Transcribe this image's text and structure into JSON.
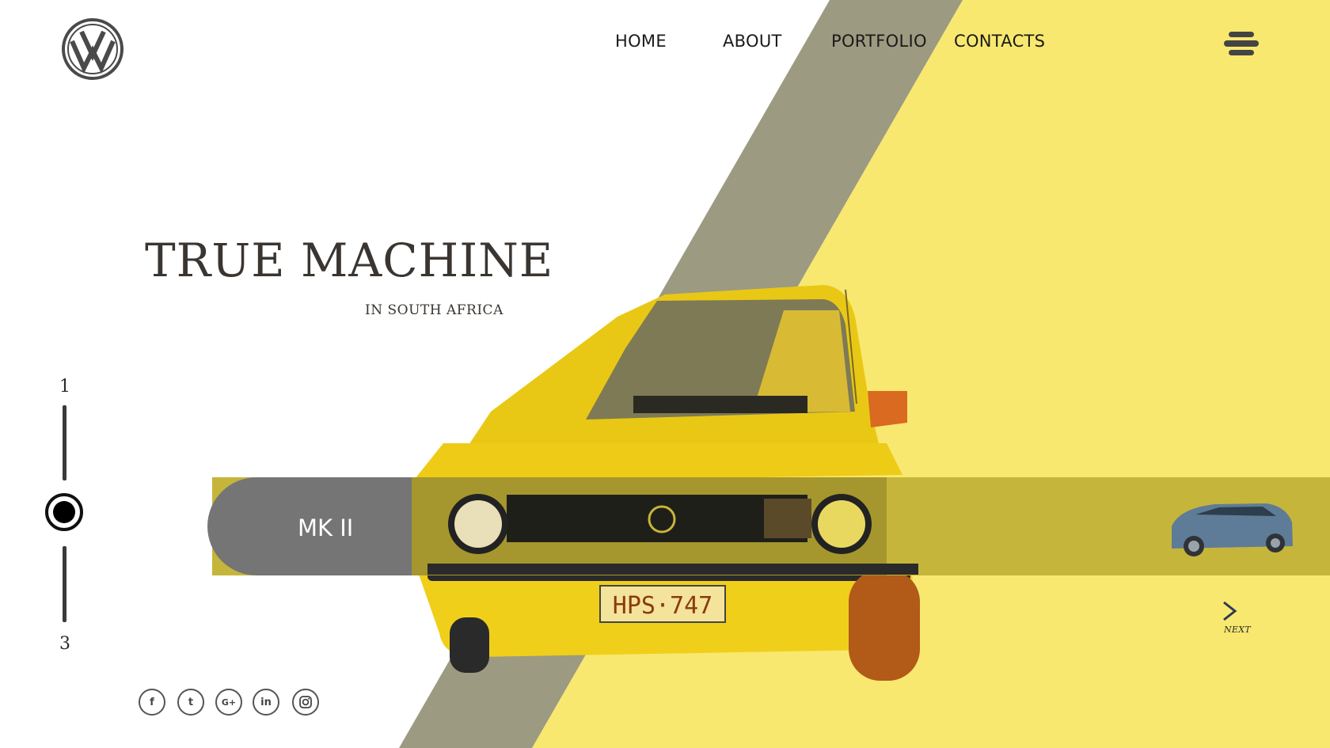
{
  "brand": {
    "logo": "vw-logo-icon"
  },
  "nav": {
    "items": [
      {
        "label": "HOME"
      },
      {
        "label": "ABOUT"
      },
      {
        "label": "PORTFOLIO"
      },
      {
        "label": "CONTACTS"
      }
    ]
  },
  "menu": {
    "icon": "hamburger-menu-icon"
  },
  "hero": {
    "title": "TRUE MACHINE",
    "subtitle": "IN SOUTH AFRICA"
  },
  "pager": {
    "first": "1",
    "last": "3"
  },
  "slide": {
    "model": "MK II",
    "plate": "HPS·747"
  },
  "next": {
    "label": "NEXT",
    "icon": "chevron-right-icon"
  },
  "social": [
    {
      "icon": "facebook-icon",
      "glyph": "f"
    },
    {
      "icon": "twitter-icon",
      "glyph": "t"
    },
    {
      "icon": "google-plus-icon",
      "glyph": "G+"
    },
    {
      "icon": "linkedin-icon",
      "glyph": "in"
    },
    {
      "icon": "instagram-icon",
      "glyph": ""
    }
  ],
  "colors": {
    "accent_yellow": "#F8E870",
    "band_gray": "#757575",
    "stripe_gray": "#9C9A80",
    "car_yellow": "#F2D21A"
  }
}
